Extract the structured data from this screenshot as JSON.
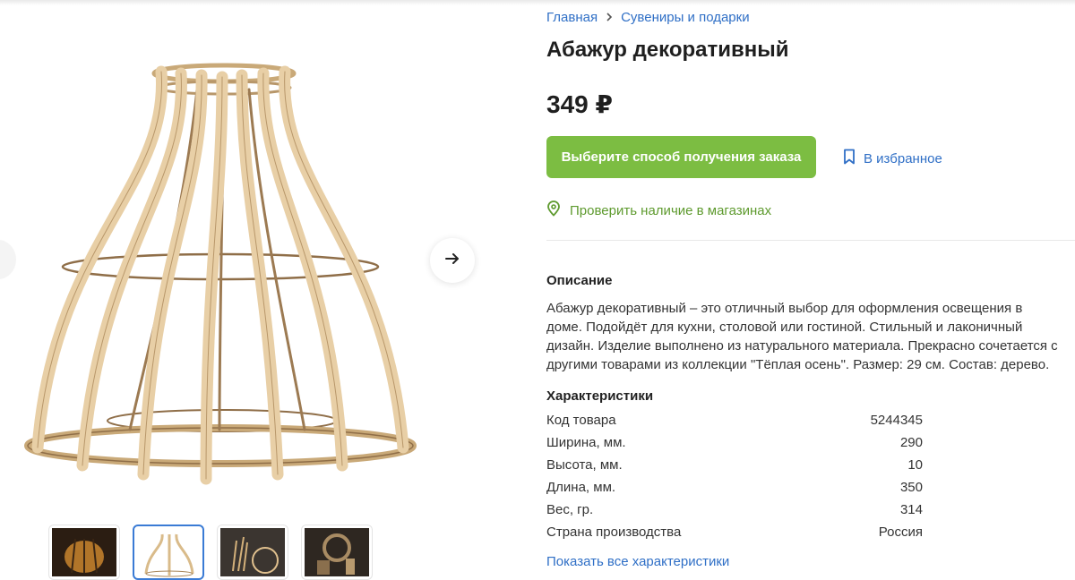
{
  "breadcrumb": {
    "home": "Главная",
    "category": "Сувениры и подарки"
  },
  "product": {
    "title": "Абажур декоративный",
    "price": "349 ₽",
    "order_button": "Выберите способ получения заказа",
    "favorite_label": "В избранное",
    "check_stock_label": "Проверить наличие в магазинах"
  },
  "description": {
    "heading": "Описание",
    "text": "Абажур декоративный – это отличный выбор для оформления освещения в доме. Подойдёт для кухни, столовой или гостиной. Стильный и лаконичный дизайн. Изделие выполнено из натурального материала. Прекрасно сочетается с другими товарами из коллекции \"Тёплая осень\". Размер: 29 см. Состав: дерево."
  },
  "specs": {
    "heading": "Характеристики",
    "rows": [
      {
        "label": "Код товара",
        "value": "5244345"
      },
      {
        "label": "Ширина, мм.",
        "value": "290"
      },
      {
        "label": "Высота, мм.",
        "value": "10"
      },
      {
        "label": "Длина, мм.",
        "value": "350"
      },
      {
        "label": "Вес, гр.",
        "value": "314"
      },
      {
        "label": "Страна производства",
        "value": "Россия"
      }
    ],
    "show_all": "Показать все характеристики"
  },
  "icons": {
    "next": "arrow-right-icon",
    "favorite": "bookmark-icon",
    "stock": "map-pin-icon"
  },
  "colors": {
    "accent_green": "#7cbd42",
    "link_blue": "#2f6fc6",
    "stock_green": "#5e9a2e",
    "wood": "#e8cfa6"
  }
}
